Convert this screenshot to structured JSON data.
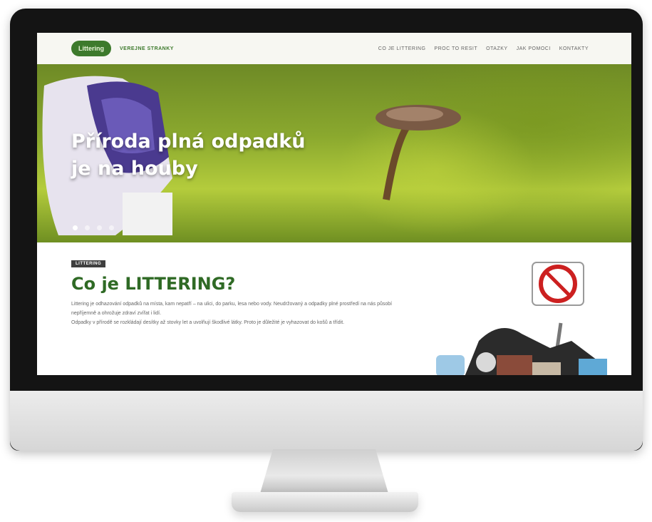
{
  "site": {
    "logo_text": "Littering",
    "tagline": "VEREJNE STRANKY"
  },
  "nav": {
    "items": [
      "CO JE LITTERING",
      "PROC TO RESIT",
      "OTAZKY",
      "JAK POMOCI",
      "KONTAKTY"
    ]
  },
  "hero": {
    "title_line1": "Příroda plná odpadků",
    "title_line2": "je na houby",
    "slides": 4,
    "active_slide": 0
  },
  "intro": {
    "badge": "LITTERING",
    "title": "Co je LITTERING?",
    "paragraph1": "Littering je odhazování odpadků na místa, kam nepatří – na ulici, do parku, lesa nebo vody. Neudržovaný a odpadky plné prostředí na nás působí nepříjemně a ohrožuje zdraví zvířat i lidí.",
    "paragraph2": "Odpadky v přírodě se rozkládají desítky až stovky let a uvolňují škodlivé látky. Proto je důležité je vyhazovat do košů a třídit."
  },
  "colors": {
    "brand_green": "#3d7a2c",
    "title_green": "#2f6a25"
  }
}
